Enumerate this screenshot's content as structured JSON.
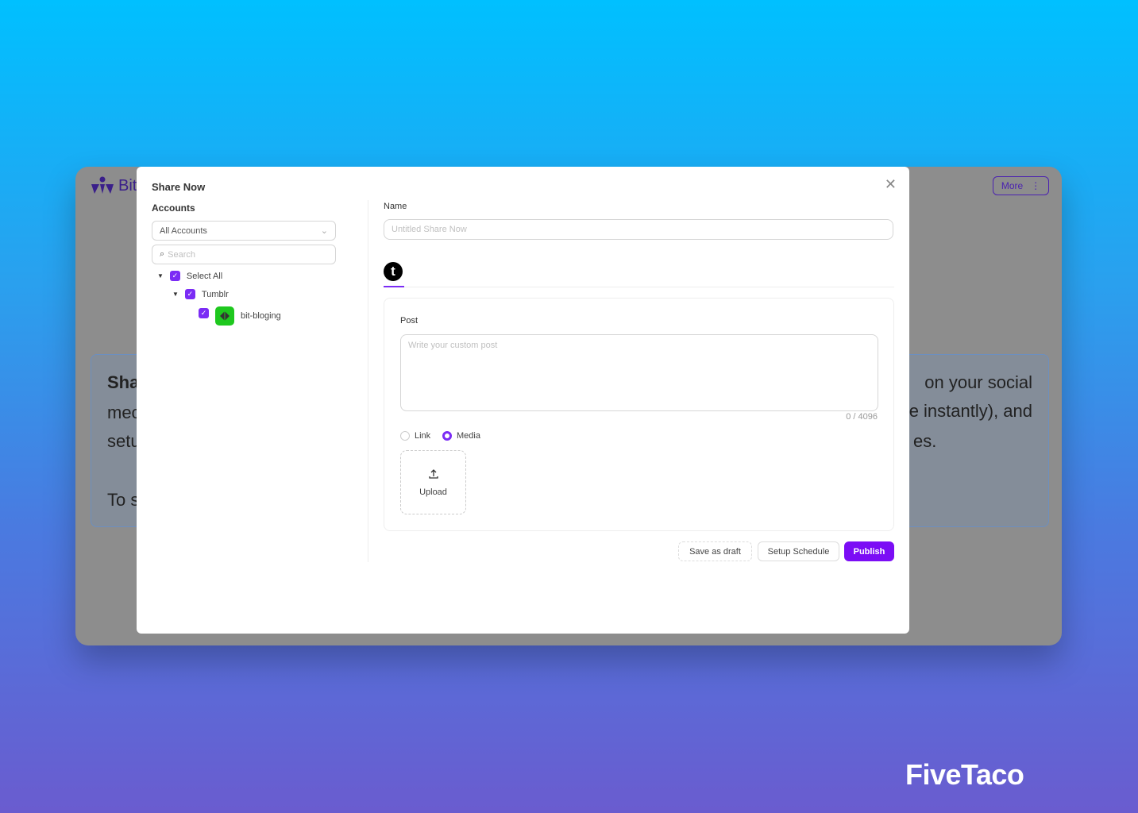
{
  "background_app": {
    "logo_text": "Bit",
    "more_label": "More",
    "card_left_lines": [
      "Sha",
      "mec",
      "setu",
      "To s"
    ],
    "card_right_lines": [
      "on your social",
      "e instantly), and",
      "es."
    ]
  },
  "modal": {
    "title": "Share Now",
    "accounts_label": "Accounts",
    "accounts_select": "All Accounts",
    "search_placeholder": "Search",
    "select_all": "Select All",
    "group": "Tumblr",
    "account": "bit-bloging",
    "name_label": "Name",
    "name_placeholder": "Untitled Share Now",
    "platform_tab": "tumblr-icon",
    "post_label": "Post",
    "post_placeholder": "Write your custom post",
    "char_count": "0 / 4096",
    "radio_link": "Link",
    "radio_media": "Media",
    "selected_radio": "Media",
    "upload_label": "Upload",
    "save_draft": "Save as draft",
    "setup_schedule": "Setup Schedule",
    "publish": "Publish"
  },
  "colors": {
    "accent": "#7b2cf5",
    "overlay": "#8d8d8d"
  },
  "brand": "FiveTaco"
}
